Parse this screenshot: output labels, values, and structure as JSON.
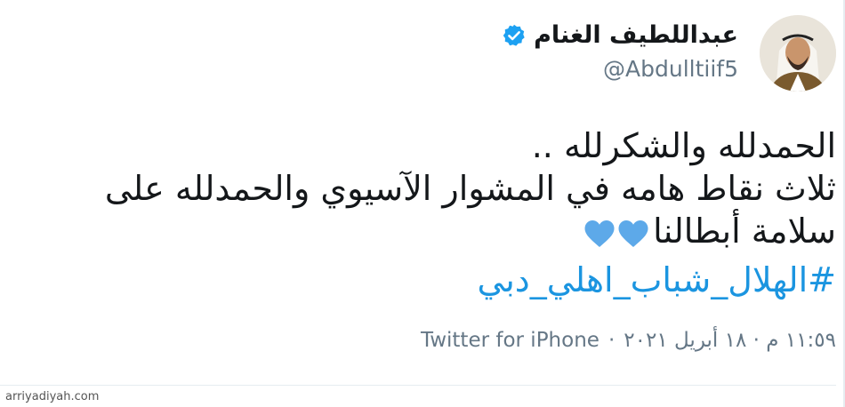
{
  "user": {
    "display_name": "عبداللطيف الغنام",
    "handle": "@Abdulltiif5",
    "verified_icon": "verified-badge-icon",
    "avatar_icon": "profile-photo"
  },
  "tweet": {
    "lines": [
      "الحمدلله والشكرلله ..",
      "ثلاث نقاط هامه في المشوار الآسيوي والحمدلله على",
      "سلامة أبطالنا"
    ],
    "hearts_icon": "blue-heart-icon",
    "hashtag": "#الهلال_شباب_اهلي_دبي"
  },
  "meta": {
    "time_date": "١١:٥٩ م · ١٨ أبريل ٢٠٢١",
    "separator": "·",
    "client": "Twitter for iPhone"
  },
  "watermark": "arriyadiyah.com",
  "colors": {
    "link_blue": "#1b95e0",
    "heart_blue": "#5da9e9",
    "verified_blue": "#1da1f2",
    "text": "#14171a",
    "muted": "#657786"
  }
}
